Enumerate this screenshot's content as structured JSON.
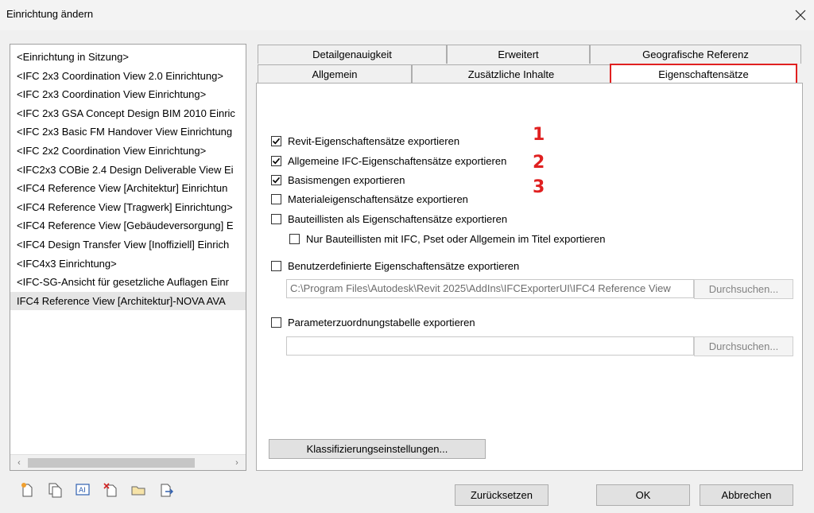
{
  "window": {
    "title": "Einrichtung ändern",
    "close_icon": "close-icon"
  },
  "setups": [
    "<Einrichtung in Sitzung>",
    "<IFC 2x3 Coordination View 2.0 Einrichtung>",
    "<IFC 2x3 Coordination View Einrichtung>",
    "<IFC 2x3 GSA Concept Design BIM 2010 Einric",
    "<IFC 2x3 Basic FM Handover View Einrichtung",
    "<IFC 2x2 Coordination View Einrichtung>",
    "<IFC2x3 COBie 2.4 Design Deliverable View Ei",
    "<IFC4 Reference View [Architektur] Einrichtun",
    "<IFC4 Reference View [Tragwerk] Einrichtung>",
    "<IFC4 Reference View [Gebäudeversorgung] E",
    "<IFC4 Design Transfer View [Inoffiziell] Einrich",
    "<IFC4x3 Einrichtung>",
    "<IFC-SG-Ansicht für gesetzliche Auflagen Einr",
    "IFC4 Reference View [Architektur]-NOVA AVA"
  ],
  "selected_setup": "IFC4 Reference View [Architektur]-NOVA AVA",
  "toolbar": {
    "icons": [
      "new-setup-icon",
      "duplicate-setup-icon",
      "rename-setup-icon",
      "delete-setup-icon",
      "import-setup-icon",
      "export-setup-icon"
    ]
  },
  "tabs": {
    "row_back": [
      "Detailgenauigkeit",
      "Erweitert",
      "Geografische Referenz"
    ],
    "row_front": [
      "Allgemein",
      "Zusätzliche Inhalte",
      "Eigenschaftensätze"
    ],
    "active": "Eigenschaftensätze"
  },
  "options": {
    "revit_psets": {
      "label": "Revit-Eigenschaftensätze exportieren",
      "checked": true
    },
    "ifc_common_psets": {
      "label": "Allgemeine IFC-Eigenschaftensätze exportieren",
      "checked": true
    },
    "base_quantities": {
      "label": "Basismengen exportieren",
      "checked": true
    },
    "material_psets": {
      "label": "Materialeigenschaftensätze exportieren",
      "checked": false
    },
    "schedules_as_psets": {
      "label": "Bauteillisten als Eigenschaftensätze exportieren",
      "checked": false
    },
    "schedules_filter": {
      "label": "Nur Bauteillisten mit IFC, Pset oder Allgemein im Titel exportieren",
      "checked": false
    },
    "user_defined_psets": {
      "label": "Benutzerdefinierte Eigenschaftensätze exportieren",
      "checked": false
    },
    "param_mapping": {
      "label": "Parameterzuordnungstabelle exportieren",
      "checked": false
    }
  },
  "annotations": {
    "num1": "1",
    "num2": "2",
    "num3": "3"
  },
  "paths": {
    "user_defined_path": "C:\\Program Files\\Autodesk\\Revit 2025\\AddIns\\IFCExporterUI\\IFC4 Reference View",
    "param_mapping_path": ""
  },
  "buttons": {
    "browse": "Durchsuchen...",
    "classification": "Klassifizierungseinstellungen...",
    "reset": "Zurücksetzen",
    "ok": "OK",
    "cancel": "Abbrechen"
  },
  "colors": {
    "highlight": "#e02020",
    "selected_row": "#e5e5e5"
  }
}
